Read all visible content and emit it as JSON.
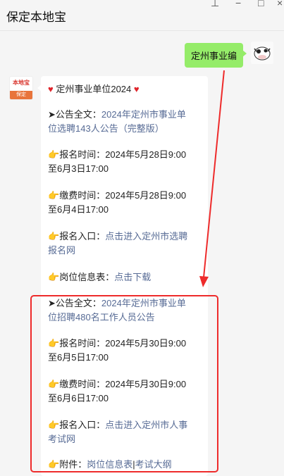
{
  "window": {
    "title": "保定本地宝",
    "controls": {
      "pin": "⊥",
      "min": "−",
      "max": "□",
      "close": "×"
    }
  },
  "outgoing": {
    "text": "定州事业编"
  },
  "incoming": {
    "avatar": {
      "logo": "本地宝",
      "label": "保定"
    },
    "header": "定州事业单位2024",
    "block1": {
      "notice_prefix": "➤公告全文：",
      "notice_link_1": "2024年定州市事业单",
      "notice_link_2": "位选聘143人公告（完整版）",
      "reg_time_prefix": "报名时间：2024年5月28日9:00",
      "reg_time_end": "至6月3日17:00",
      "pay_time_prefix": "缴费时间：2024年5月28日9:00",
      "pay_time_end": "至6月4日17:00",
      "entry_prefix": "报名入口：",
      "entry_link_1": "点击进入定州市选聘",
      "entry_link_2": "报名网",
      "table_prefix": "岗位信息表：",
      "table_link": "点击下载"
    },
    "block2": {
      "notice_prefix": "➤公告全文：",
      "notice_link_1": "2024年定州市事业单",
      "notice_link_2": "位招聘480名工作人员公告",
      "reg_time_prefix": "报名时间：2024年5月30日9:00",
      "reg_time_end": "至6月5日17:00",
      "pay_time_prefix": "缴费时间：2024年5月30日9:00",
      "pay_time_end": "至6月6日17:00",
      "entry_prefix": "报名入口：",
      "entry_link_1": "点击进入定州市人事",
      "entry_link_2": "考试网",
      "attach_prefix": "附件：",
      "attach_link_1": "岗位信息表",
      "attach_sep": "|",
      "attach_link_2": "考试大纲"
    }
  },
  "icons": {
    "hand": "👉",
    "heart": "♥"
  },
  "colors": {
    "bubble_out": "#95ec69",
    "link": "#576b95",
    "annotation": "#ee2b2b"
  }
}
